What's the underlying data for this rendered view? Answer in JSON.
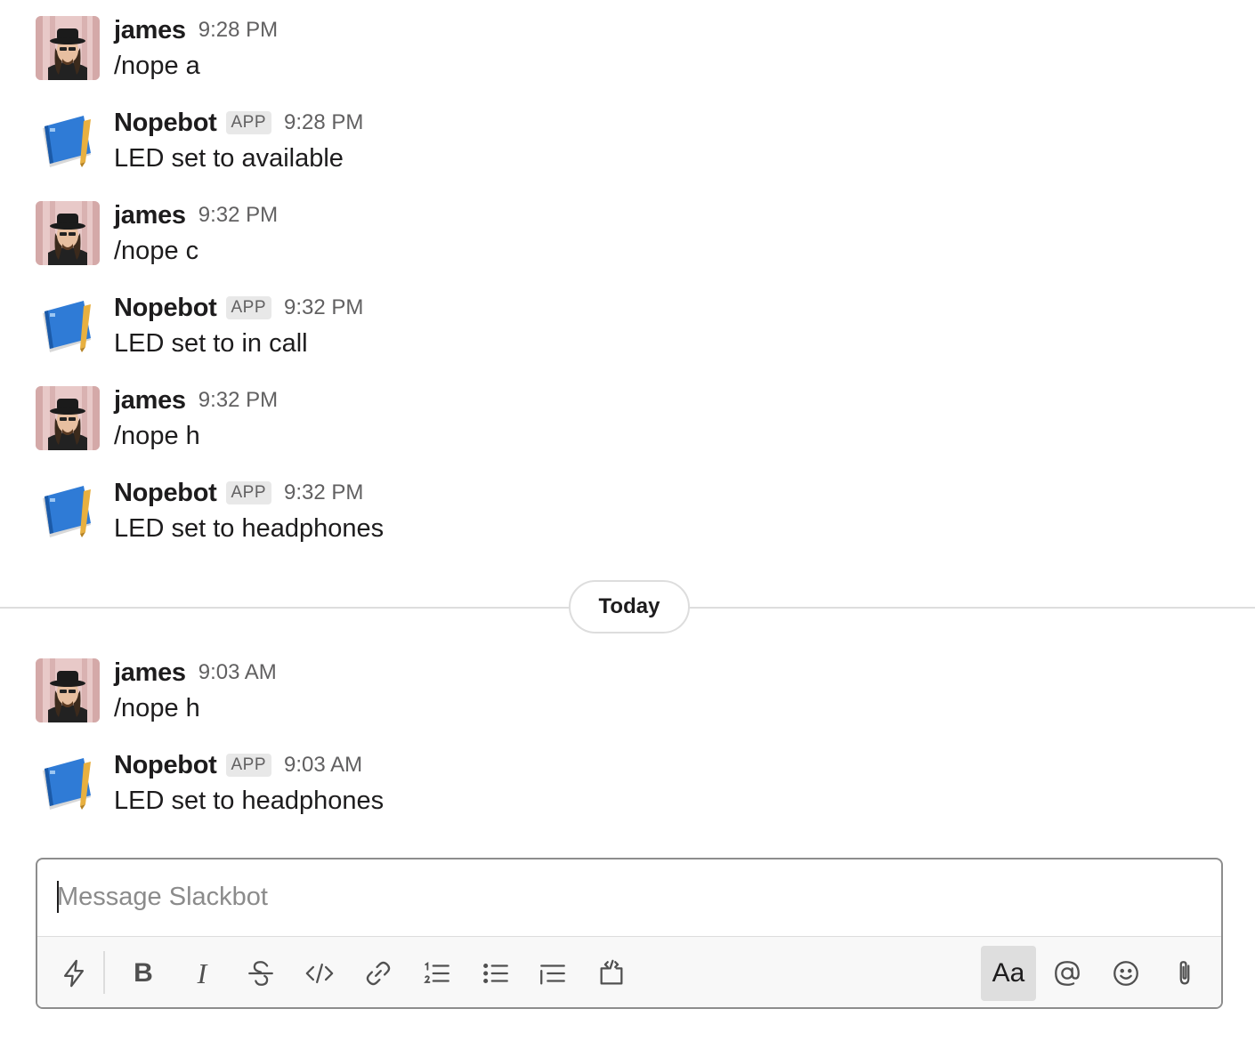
{
  "messages": [
    {
      "sender": "james",
      "time": "9:28 PM",
      "text": "/nope a",
      "is_app": false
    },
    {
      "sender": "Nopebot",
      "badge": "APP",
      "time": "9:28 PM",
      "text": "LED set to available",
      "is_app": true
    },
    {
      "sender": "james",
      "time": "9:32 PM",
      "text": "/nope c",
      "is_app": false
    },
    {
      "sender": "Nopebot",
      "badge": "APP",
      "time": "9:32 PM",
      "text": "LED set to in call",
      "is_app": true
    },
    {
      "sender": "james",
      "time": "9:32 PM",
      "text": "/nope h",
      "is_app": false
    },
    {
      "sender": "Nopebot",
      "badge": "APP",
      "time": "9:32 PM",
      "text": "LED set to headphones",
      "is_app": true
    },
    {
      "sender": "james",
      "time": "9:03 AM",
      "text": "/nope h",
      "is_app": false
    },
    {
      "sender": "Nopebot",
      "badge": "APP",
      "time": "9:03 AM",
      "text": "LED set to headphones",
      "is_app": true
    }
  ],
  "divider": {
    "label": "Today"
  },
  "composer": {
    "placeholder": "Message Slackbot",
    "value": "",
    "format_label": "Aa",
    "bold_label": "B",
    "italic_label": "I"
  },
  "icons": {
    "shortcuts": "lightning-icon",
    "strike": "strikethrough-icon",
    "code": "code-icon",
    "link": "link-icon",
    "ordered": "ordered-list-icon",
    "bulleted": "bulleted-list-icon",
    "quote": "blockquote-icon",
    "codeblock": "code-block-icon",
    "mention": "at-mention-icon",
    "emoji": "emoji-icon",
    "attach": "paperclip-icon"
  },
  "colors": {
    "text": "#1d1c1d",
    "muted": "#616061",
    "badge_bg": "#e8e8e8",
    "divider": "#dddddd",
    "composer_border": "#8d8d8d",
    "bot_book_blue": "#2f7bd6",
    "bot_pencil": "#e8b040"
  }
}
